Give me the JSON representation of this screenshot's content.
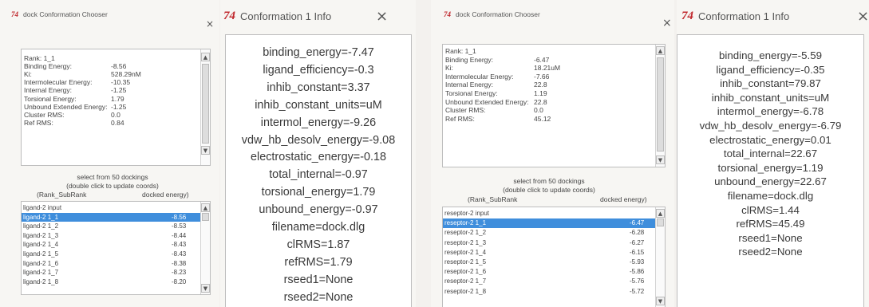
{
  "accent": "#3f8edc",
  "logo_color": "#c0282d",
  "window1": {
    "title": "dock Conformation Chooser",
    "close_icon": "×",
    "details": [
      [
        "Rank: 1_1",
        ""
      ],
      [
        "Binding Energy:",
        "-8.56"
      ],
      [
        "Ki:",
        "528.29nM"
      ],
      [
        "Intermolecular Energy:",
        "-10.35"
      ],
      [
        "Internal Energy:",
        "-1.25"
      ],
      [
        "Torsional Energy:",
        "1.79"
      ],
      [
        "Unbound Extended Energy:",
        "-1.25"
      ],
      [
        "Cluster RMS:",
        "0.0"
      ],
      [
        "Ref RMS:",
        "0.84"
      ]
    ],
    "instruction_1": "select from 50 dockings",
    "instruction_2": "(double click to update coords)",
    "col_rank": "(Rank_SubRank",
    "col_energy": "docked energy)",
    "list": [
      [
        "ligand-2 input",
        ""
      ],
      [
        "ligand-2 1_1",
        "-8.56"
      ],
      [
        "ligand-2 1_2",
        "-8.53"
      ],
      [
        "ligand-2 1_3",
        "-8.44"
      ],
      [
        "ligand-2 1_4",
        "-8.43"
      ],
      [
        "ligand-2 1_5",
        "-8.43"
      ],
      [
        "ligand-2 1_6",
        "-8.38"
      ],
      [
        "ligand-2 1_7",
        "-8.23"
      ],
      [
        "ligand-2 1_8",
        "-8.20"
      ]
    ],
    "selected_index": 1
  },
  "info1": {
    "title": "Conformation 1 Info",
    "close_icon": "×",
    "logo": "74",
    "lines": [
      "binding_energy=-7.47",
      "ligand_efficiency=-0.3",
      "inhib_constant=3.37",
      "inhib_constant_units=uM",
      "intermol_energy=-9.26",
      "vdw_hb_desolv_energy=-9.08",
      "electrostatic_energy=-0.18",
      "total_internal=-0.97",
      "torsional_energy=1.79",
      "unbound_energy=-0.97",
      "filename=dock.dlg",
      "clRMS=1.87",
      "refRMS=1.79",
      "rseed1=None",
      "rseed2=None"
    ]
  },
  "window2": {
    "title": "dock Conformation Chooser",
    "close_icon": "×",
    "details": [
      [
        "Rank: 1_1",
        ""
      ],
      [
        "Binding Energy:",
        "-6.47"
      ],
      [
        "Ki:",
        "18.21uM"
      ],
      [
        "Intermolecular Energy:",
        "-7.66"
      ],
      [
        "Internal Energy:",
        "22.8"
      ],
      [
        "Torsional Energy:",
        "1.19"
      ],
      [
        "Unbound Extended Energy:",
        "22.8"
      ],
      [
        "Cluster RMS:",
        "0.0"
      ],
      [
        "Ref RMS:",
        "45.12"
      ]
    ],
    "instruction_1": "select from 50 dockings",
    "instruction_2": "(double click to update coords)",
    "col_rank": "(Rank_SubRank",
    "col_energy": "docked energy)",
    "list": [
      [
        "reseptor-2 input",
        ""
      ],
      [
        "reseptor-2 1_1",
        "-6.47"
      ],
      [
        "reseptor-2 1_2",
        "-6.28"
      ],
      [
        "reseptor-2 1_3",
        "-6.27"
      ],
      [
        "reseptor-2 1_4",
        "-6.15"
      ],
      [
        "reseptor-2 1_5",
        "-5.93"
      ],
      [
        "reseptor-2 1_6",
        "-5.86"
      ],
      [
        "reseptor-2 1_7",
        "-5.76"
      ],
      [
        "reseptor-2 1_8",
        "-5.72"
      ]
    ],
    "selected_index": 1
  },
  "info2": {
    "title": "Conformation 1 Info",
    "close_icon": "×",
    "logo": "74",
    "lines": [
      "binding_energy=-5.59",
      "ligand_efficiency=-0.35",
      "inhib_constant=79.87",
      "inhib_constant_units=uM",
      "intermol_energy=-6.78",
      "vdw_hb_desolv_energy=-6.79",
      "electrostatic_energy=0.01",
      "total_internal=22.67",
      "torsional_energy=1.19",
      "unbound_energy=22.67",
      "filename=dock.dlg",
      "clRMS=1.44",
      "refRMS=45.49",
      "rseed1=None",
      "rseed2=None"
    ]
  }
}
